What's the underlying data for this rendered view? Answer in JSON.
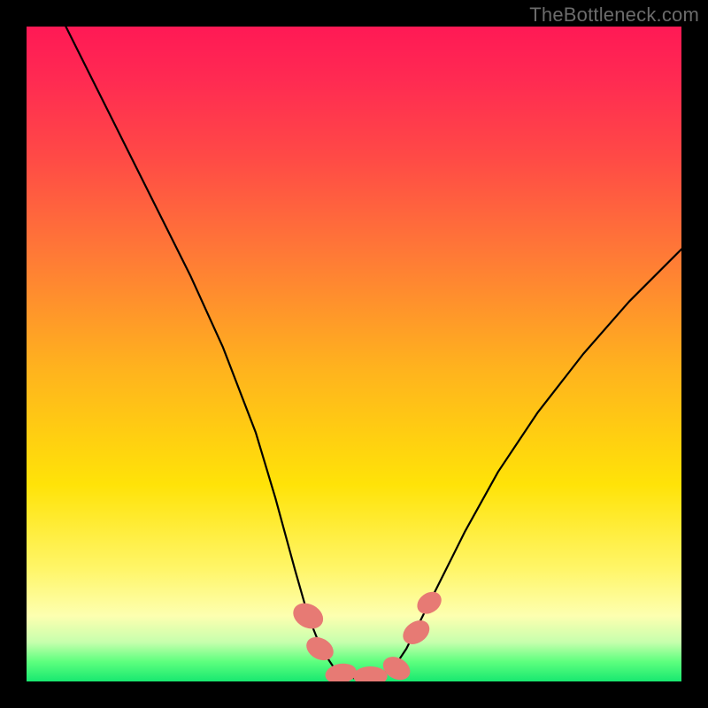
{
  "watermark": "TheBottleneck.com",
  "chart_data": {
    "type": "line",
    "title": "",
    "xlabel": "",
    "ylabel": "",
    "xlim": [
      0,
      100
    ],
    "ylim": [
      0,
      100
    ],
    "series": [
      {
        "name": "curve",
        "x": [
          6,
          10,
          15,
          20,
          25,
          30,
          35,
          38,
          41,
          43,
          45,
          47,
          50,
          53,
          56,
          58,
          60,
          63,
          67,
          72,
          78,
          85,
          92,
          100
        ],
        "y": [
          100,
          92,
          82,
          72,
          62,
          51,
          38,
          28,
          17,
          10,
          5,
          2,
          0.5,
          0.5,
          2,
          5,
          9,
          15,
          23,
          32,
          41,
          50,
          58,
          66
        ]
      }
    ],
    "markers": [
      {
        "name": "ellipse",
        "cx": 43.0,
        "cy": 10.0,
        "rx": 1.8,
        "ry": 2.4,
        "angle": -62
      },
      {
        "name": "ellipse",
        "cx": 44.8,
        "cy": 5.0,
        "rx": 1.6,
        "ry": 2.2,
        "angle": -60
      },
      {
        "name": "ellipse",
        "cx": 48.0,
        "cy": 1.2,
        "rx": 2.4,
        "ry": 1.5,
        "angle": -10
      },
      {
        "name": "ellipse",
        "cx": 52.5,
        "cy": 0.8,
        "rx": 2.6,
        "ry": 1.5,
        "angle": 0
      },
      {
        "name": "ellipse",
        "cx": 56.5,
        "cy": 2.0,
        "rx": 2.2,
        "ry": 1.6,
        "angle": 30
      },
      {
        "name": "ellipse",
        "cx": 59.5,
        "cy": 7.5,
        "rx": 1.6,
        "ry": 2.2,
        "angle": 55
      },
      {
        "name": "ellipse",
        "cx": 61.5,
        "cy": 12.0,
        "rx": 1.5,
        "ry": 2.0,
        "angle": 55
      }
    ],
    "gradient_stops": [
      {
        "pos": 0,
        "color": "#ff1955"
      },
      {
        "pos": 20,
        "color": "#ff4a46"
      },
      {
        "pos": 50,
        "color": "#ffb21e"
      },
      {
        "pos": 75,
        "color": "#fff04a"
      },
      {
        "pos": 93,
        "color": "#dfffb0"
      },
      {
        "pos": 100,
        "color": "#18e870"
      }
    ]
  }
}
